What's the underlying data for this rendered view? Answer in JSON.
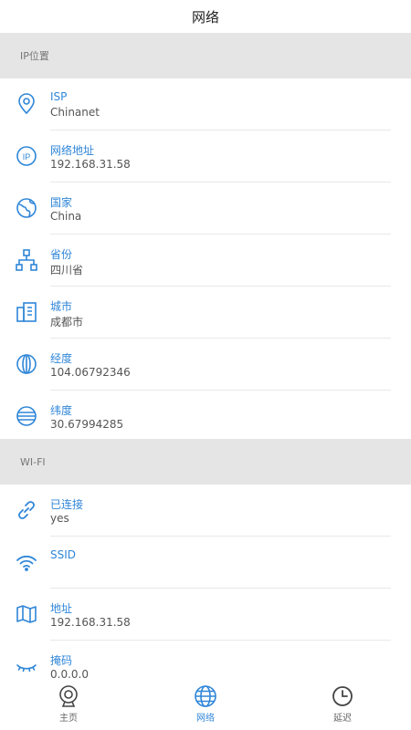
{
  "title": "网络",
  "accent_color": "#2f86d8",
  "sections": [
    {
      "header": "IP位置",
      "items": [
        {
          "icon": "location-pin-icon",
          "label": "ISP",
          "value": "Chinanet"
        },
        {
          "icon": "ip-icon",
          "label": "网络地址",
          "value": "192.168.31.58"
        },
        {
          "icon": "globe-icon",
          "label": "国家",
          "value": "China"
        },
        {
          "icon": "network-tree-icon",
          "label": "省份",
          "value": "四川省"
        },
        {
          "icon": "building-icon",
          "label": "城市",
          "value": "成都市"
        },
        {
          "icon": "longitude-icon",
          "label": "经度",
          "value": "104.06792346"
        },
        {
          "icon": "latitude-icon",
          "label": "纬度",
          "value": "30.67994285"
        }
      ]
    },
    {
      "header": "WI-FI",
      "items": [
        {
          "icon": "link-icon",
          "label": "已连接",
          "value": "yes"
        },
        {
          "icon": "wifi-icon",
          "label": "SSID",
          "value": ""
        },
        {
          "icon": "map-icon",
          "label": "地址",
          "value": "192.168.31.58"
        },
        {
          "icon": "eye-closed-icon",
          "label": "掩码",
          "value": "0.0.0.0"
        }
      ]
    }
  ],
  "nav": [
    {
      "icon": "home-icon",
      "label": "主页",
      "active": false
    },
    {
      "icon": "globe-icon",
      "label": "网络",
      "active": true
    },
    {
      "icon": "clock-icon",
      "label": "延迟",
      "active": false
    }
  ]
}
